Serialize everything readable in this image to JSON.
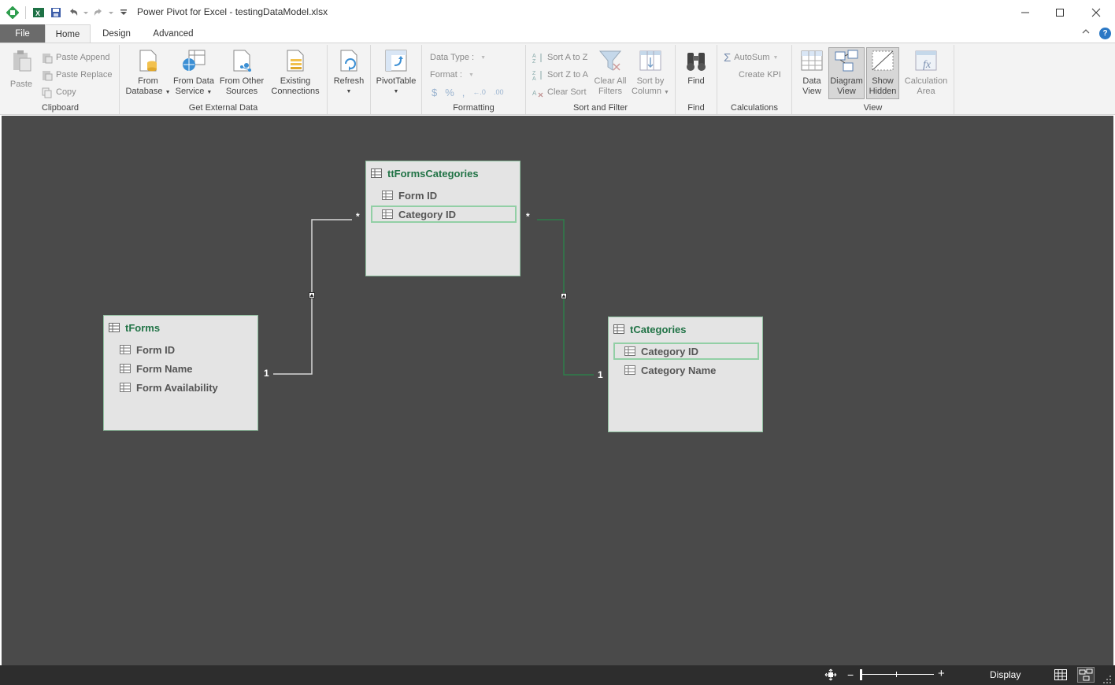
{
  "window": {
    "title": "Power Pivot for Excel - testingDataModel.xlsx"
  },
  "tabs": [
    {
      "label": "File"
    },
    {
      "label": "Home"
    },
    {
      "label": "Design"
    },
    {
      "label": "Advanced"
    }
  ],
  "ribbon": {
    "clipboard": {
      "label": "Clipboard",
      "paste": "Paste",
      "paste_append": "Paste Append",
      "paste_replace": "Paste Replace",
      "copy": "Copy"
    },
    "external": {
      "label": "Get External Data",
      "from_database": [
        "From",
        "Database"
      ],
      "from_data_service": [
        "From Data",
        "Service"
      ],
      "from_other_sources": [
        "From Other",
        "Sources"
      ],
      "existing_connections": [
        "Existing",
        "Connections"
      ]
    },
    "refresh": "Refresh",
    "pivottable": "PivotTable",
    "formatting": {
      "label": "Formatting",
      "data_type": "Data Type :",
      "format": "Format :"
    },
    "sort_filter": {
      "label": "Sort and Filter",
      "sort_az": "Sort A to Z",
      "sort_za": "Sort Z to A",
      "clear_sort": "Clear Sort",
      "clear_all_filters": [
        "Clear All",
        "Filters"
      ],
      "sort_by_column": [
        "Sort by",
        "Column"
      ]
    },
    "find": {
      "label": "Find",
      "find": "Find"
    },
    "calculations": {
      "label": "Calculations",
      "autosum": "AutoSum",
      "create_kpi": "Create KPI"
    },
    "view": {
      "label": "View",
      "data_view": [
        "Data",
        "View"
      ],
      "diagram_view": [
        "Diagram",
        "View"
      ],
      "show_hidden": [
        "Show",
        "Hidden"
      ],
      "calculation_area": [
        "Calculation",
        "Area"
      ]
    }
  },
  "diagram": {
    "tables": [
      {
        "name": "ttFormsCategories",
        "columns": [
          {
            "name": "Form ID",
            "selected": false
          },
          {
            "name": "Category ID",
            "selected": true
          }
        ]
      },
      {
        "name": "tForms",
        "columns": [
          {
            "name": "Form ID",
            "selected": false
          },
          {
            "name": "Form Name",
            "selected": false
          },
          {
            "name": "Form Availability",
            "selected": false
          }
        ]
      },
      {
        "name": "tCategories",
        "columns": [
          {
            "name": "Category ID",
            "selected": true
          },
          {
            "name": "Category Name",
            "selected": false
          }
        ]
      }
    ],
    "relationships": [
      {
        "from": "tForms",
        "to": "ttFormsCategories",
        "one_label": "1",
        "many_label": "*",
        "highlighted": false
      },
      {
        "from": "tCategories",
        "to": "ttFormsCategories",
        "one_label": "1",
        "many_label": "*",
        "highlighted": true
      }
    ]
  },
  "statusbar": {
    "display_label": "Display"
  },
  "colors": {
    "canvas": "#4a4a4a",
    "table_title": "#217346",
    "selected_border": "#92cfa5",
    "highlight_line": "#2e7d4a"
  }
}
